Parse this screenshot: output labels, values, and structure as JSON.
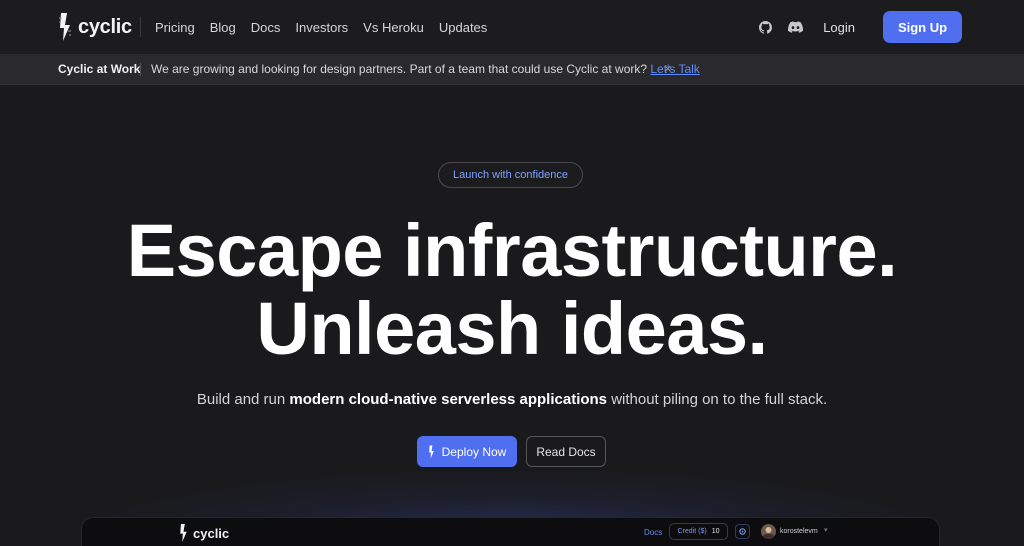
{
  "nav": {
    "brand": "cyclic",
    "links": [
      "Pricing",
      "Blog",
      "Docs",
      "Investors",
      "Vs Heroku",
      "Updates"
    ],
    "login": "Login",
    "signup": "Sign Up",
    "icons": [
      "github-icon",
      "discord-icon"
    ]
  },
  "banner": {
    "title": "Cyclic at Work",
    "text": "We are growing and looking for design partners. Part of a team that could use Cyclic at work? ",
    "link": "Let's Talk",
    "close": "×"
  },
  "hero": {
    "pill": "Launch with confidence",
    "headline_1": "Escape infrastructure.",
    "headline_2": "Unleash ideas.",
    "sub_pre": "Build and run ",
    "sub_bold": "modern cloud-native serverless applications",
    "sub_post": " without piling on to the full stack.",
    "deploy": "Deploy Now",
    "docs": "Read Docs"
  },
  "preview": {
    "brand": "cyclic",
    "docs": "Docs",
    "credit_label": "Credit ($)",
    "credit_value": "10",
    "username": "korostelevm"
  },
  "colors": {
    "accent": "#4f6ef0",
    "link": "#5d8bff",
    "background": "#1a1a1c"
  }
}
